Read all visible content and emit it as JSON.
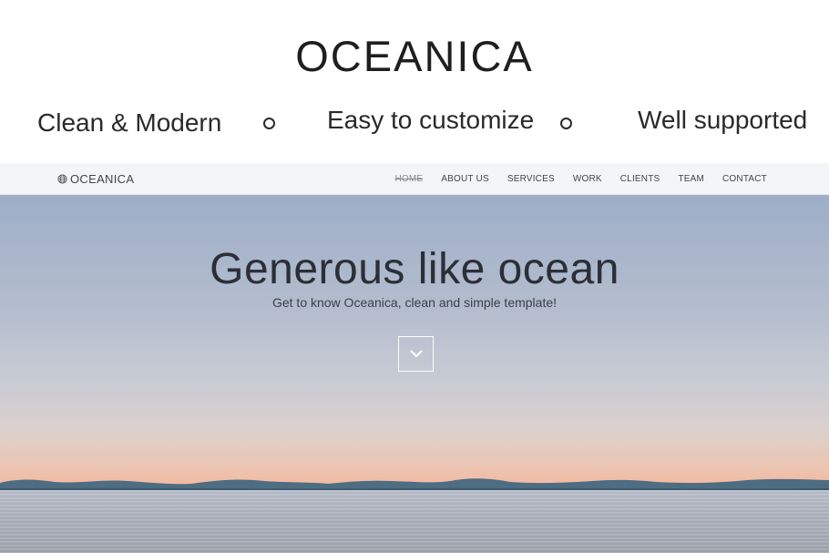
{
  "promo": {
    "title": "OCEANICA",
    "features": [
      "Clean & Modern",
      "Easy to customize",
      "Well supported"
    ]
  },
  "navbar": {
    "brand": "OCEANICA",
    "items": [
      {
        "label": "HOME",
        "active": true
      },
      {
        "label": "ABOUT US"
      },
      {
        "label": "SERVICES"
      },
      {
        "label": "WORK"
      },
      {
        "label": "CLIENTS"
      },
      {
        "label": "TEAM"
      },
      {
        "label": "CONTACT"
      }
    ]
  },
  "hero": {
    "title": "Generous like ocean",
    "subtitle": "Get to know Oceanica, clean and simple template!",
    "scroll_icon": "chevron-down-icon"
  },
  "colors": {
    "navbar_bg": "#f4f5f7",
    "sky_top": "#9eaec8",
    "sunset": "#f3b89f"
  }
}
